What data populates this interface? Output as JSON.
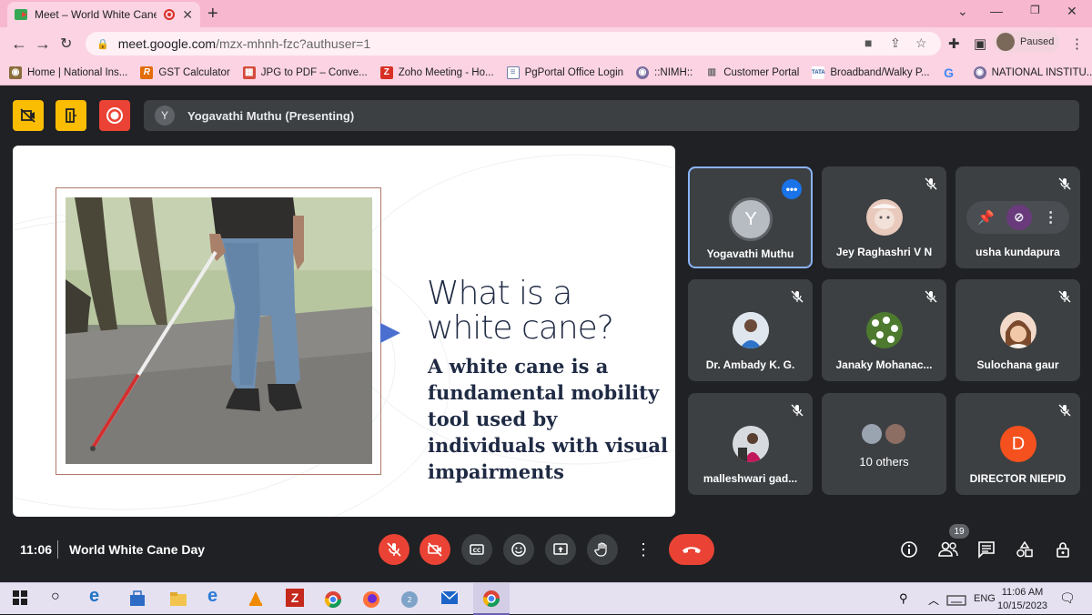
{
  "browser": {
    "tab_title": "Meet – World White Cane D",
    "address": {
      "host": "meet.google.com",
      "path": "/mzx-mhnh-fzc?authuser=1"
    },
    "profile_status": "Paused",
    "bookmarks": [
      {
        "label": "Home | National Ins...",
        "icon": "globe-icon",
        "color": "#8a6d3b"
      },
      {
        "label": "GST Calculator",
        "icon": "r-logo-icon",
        "color": "#e36c09"
      },
      {
        "label": "JPG to PDF – Conve...",
        "icon": "jpg-icon",
        "color": "#d44a3a"
      },
      {
        "label": "Zoho Meeting - Ho...",
        "icon": "z-logo-icon",
        "color": "#d93025"
      },
      {
        "label": "PgPortal Office Login",
        "icon": "doc-icon",
        "color": "#6f7fa8"
      },
      {
        "label": "::NIMH::",
        "icon": "globe-icon",
        "color": "#7a6e9e"
      },
      {
        "label": "Customer Portal",
        "icon": "bars-icon",
        "color": "#666666"
      },
      {
        "label": "Broadband/Walky P...",
        "icon": "tata-icon",
        "color": "#1f4e9a"
      },
      {
        "label": "",
        "icon": "google-icon",
        "color": "#4285f4"
      },
      {
        "label": "NATIONAL INSTITU...",
        "icon": "globe-icon",
        "color": "#7a6e9e"
      }
    ]
  },
  "meet": {
    "presenter_initial": "Y",
    "presenter_label": "Yogavathi Muthu (Presenting)",
    "slide": {
      "title_line1": "What is a",
      "title_line2": "white cane?",
      "body": "A white cane is a fundamental mobility tool used by individuals with visual impairments"
    },
    "participants": [
      {
        "name": "Yogavathi Muthu",
        "avatar": "initial",
        "initial": "Y",
        "active": true
      },
      {
        "name": "Jey Raghashri V N",
        "avatar": "photo-baby",
        "muted": true
      },
      {
        "name": "usha kundapura",
        "avatar": "hover-controls",
        "muted": true
      },
      {
        "name": "Dr. Ambady K. G.",
        "avatar": "photo-man",
        "muted": true
      },
      {
        "name": "Janaky Mohanac...",
        "avatar": "photo-flowers",
        "muted": true
      },
      {
        "name": "Sulochana gaur",
        "avatar": "photo-child",
        "muted": true
      },
      {
        "name": "malleshwari gad...",
        "avatar": "photo-woman",
        "muted": true
      },
      {
        "name": "10 others",
        "avatar": "group"
      },
      {
        "name": "DIRECTOR NIEPID",
        "avatar": "initial",
        "initial": "D",
        "initial_color": "#f4511e",
        "muted": true
      }
    ],
    "time": "11:06",
    "meeting_name": "World White Cane Day",
    "people_count": "19"
  },
  "taskbar": {
    "language": "ENG",
    "time": "11:06 AM",
    "date": "10/15/2023"
  }
}
